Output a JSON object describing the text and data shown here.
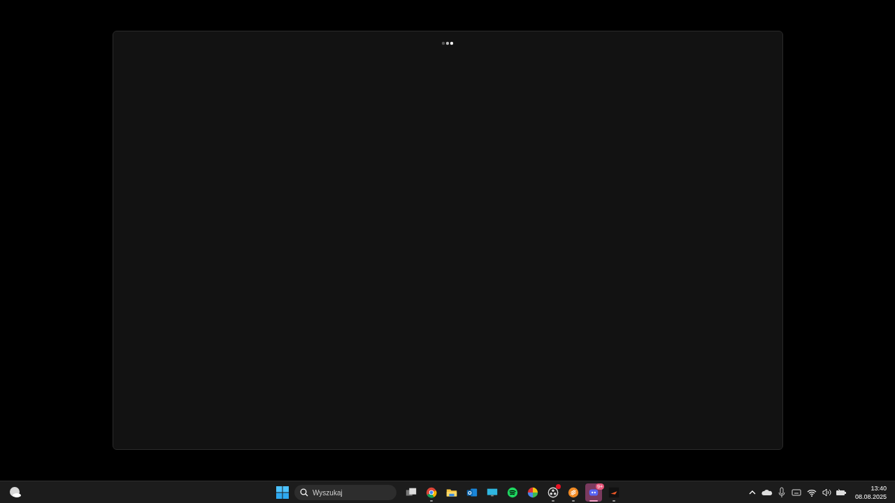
{
  "taskbar": {
    "search": {
      "placeholder": "Wyszukaj"
    },
    "apps": [
      {
        "kind": "taskview",
        "running": false,
        "selected": false,
        "alert": false
      },
      {
        "kind": "chrome",
        "running": true,
        "selected": false,
        "alert": false
      },
      {
        "kind": "folder",
        "running": false,
        "selected": false,
        "alert": false
      },
      {
        "kind": "mail",
        "running": false,
        "selected": false,
        "alert": false
      },
      {
        "kind": "monitor",
        "running": false,
        "selected": false,
        "alert": false
      },
      {
        "kind": "spotify",
        "running": false,
        "selected": false,
        "alert": false
      },
      {
        "kind": "colorwheel",
        "running": false,
        "selected": false,
        "alert": false
      },
      {
        "kind": "obs",
        "running": true,
        "selected": false,
        "alert": true
      },
      {
        "kind": "orange",
        "running": true,
        "selected": false,
        "alert": false
      },
      {
        "kind": "discord",
        "running": true,
        "selected": true,
        "alert": false,
        "badge": "9+"
      },
      {
        "kind": "dark",
        "running": true,
        "selected": false,
        "alert": false
      }
    ],
    "clock": {
      "time": "13:40",
      "date": "08.08.2025"
    }
  }
}
